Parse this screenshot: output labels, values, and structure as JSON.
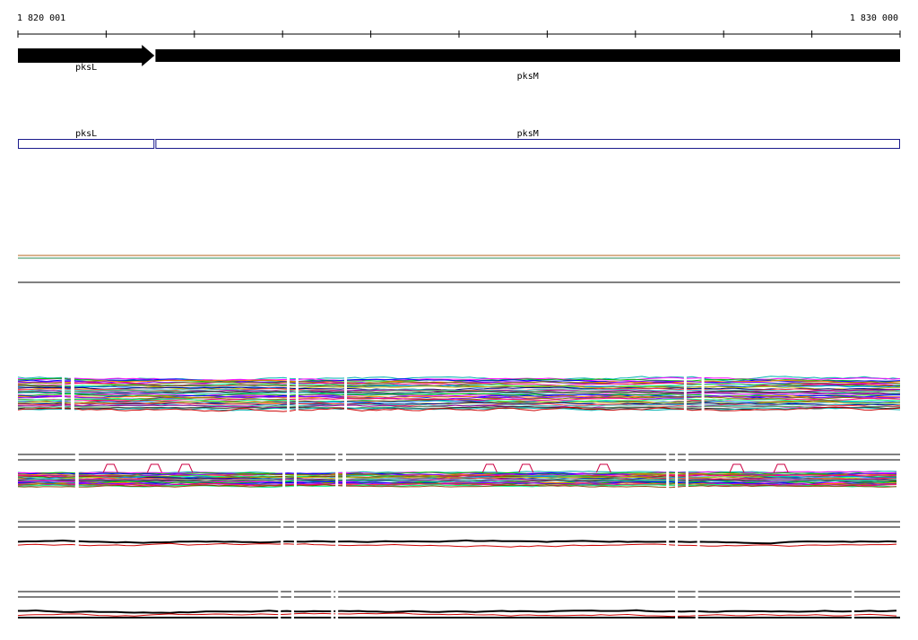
{
  "ruler": {
    "start_label": "1 820 001",
    "end_label": "1 830 000",
    "start_bp": 1820001,
    "end_bp": 1830000,
    "tick_count": 11
  },
  "genes": [
    {
      "name": "pksL",
      "start_bp": 1820001,
      "end_bp": 1821548,
      "strand": "+"
    },
    {
      "name": "pksM",
      "start_bp": 1821560,
      "end_bp": 1830000,
      "strand": "+"
    }
  ],
  "cds": [
    {
      "name": "pksL",
      "start_bp": 1820001,
      "end_bp": 1821548
    },
    {
      "name": "pksM",
      "start_bp": 1821560,
      "end_bp": 1830000
    }
  ],
  "colors": {
    "gene_fill": "#000000",
    "cds_stroke": "#1a1a8c",
    "line_a": "#b5651d",
    "line_b": "#2e8b57",
    "red": "#cc0000",
    "palette": [
      "#00b0b0",
      "#ff00ff",
      "#00c000",
      "#0000ff",
      "#ff8000",
      "#8000ff",
      "#808000",
      "#ff0080",
      "#00ff80",
      "#804000",
      "#0080ff",
      "#c0c000",
      "#000080",
      "#ff4040",
      "#40c0c0",
      "#a000a0",
      "#60a060",
      "#303030"
    ]
  },
  "chart_data": {
    "type": "line",
    "title": "",
    "xlabel": "",
    "ylabel": "",
    "xlim": [
      1820001,
      1830000
    ],
    "coverage_tracks": [
      {
        "id": "track-1",
        "series_count": 38,
        "gaps_bp": [
          [
            1820500,
            1820520
          ],
          [
            1820600,
            1820640
          ],
          [
            1823050,
            1823080
          ],
          [
            1823150,
            1823170
          ],
          [
            1823700,
            1823720
          ],
          [
            1827550,
            1827570
          ],
          [
            1827750,
            1827770
          ]
        ]
      },
      {
        "id": "track-2",
        "series_count": 28,
        "gaps_bp": [
          [
            1820650,
            1820690
          ],
          [
            1823000,
            1823030
          ],
          [
            1823130,
            1823160
          ],
          [
            1823600,
            1823630
          ],
          [
            1823680,
            1823720
          ],
          [
            1827350,
            1827380
          ],
          [
            1827450,
            1827480
          ],
          [
            1827570,
            1827600
          ]
        ],
        "peaks_bp": [
          1821050,
          1821550,
          1821900,
          1825350,
          1825760,
          1826640,
          1828150,
          1828650
        ]
      },
      {
        "id": "track-3",
        "series_count": 4,
        "gaps_bp": [
          [
            1820650,
            1820690
          ],
          [
            1822980,
            1823010
          ],
          [
            1823130,
            1823160
          ],
          [
            1823600,
            1823620
          ],
          [
            1827350,
            1827380
          ],
          [
            1827450,
            1827480
          ],
          [
            1827700,
            1827730
          ]
        ]
      },
      {
        "id": "track-4",
        "series_count": 4,
        "gaps_bp": [
          [
            1822950,
            1822980
          ],
          [
            1823100,
            1823120
          ],
          [
            1823550,
            1823570
          ],
          [
            1823600,
            1823620
          ],
          [
            1827450,
            1827480
          ],
          [
            1827680,
            1827710
          ],
          [
            1829450,
            1829480
          ]
        ]
      }
    ]
  }
}
